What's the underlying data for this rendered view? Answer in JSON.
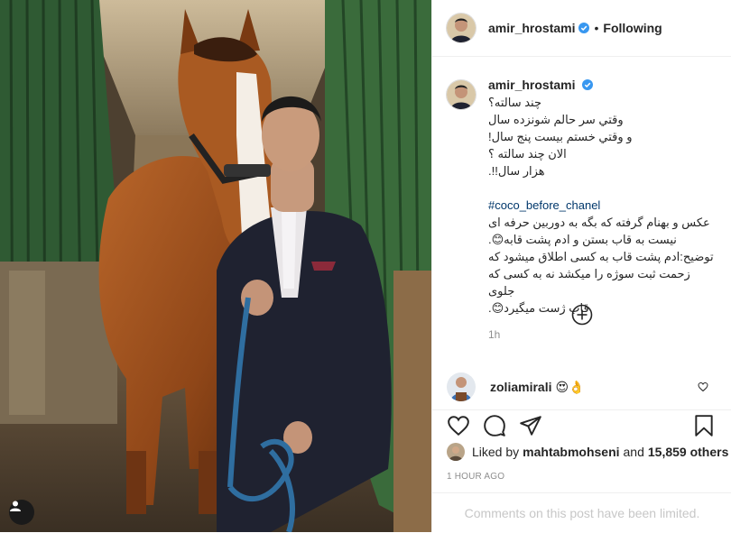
{
  "post": {
    "author": "amir_hrostami",
    "follow_status": "Following",
    "separator": "•"
  },
  "caption": {
    "author": "amir_hrostami",
    "lines": [
      "چند سالته؟",
      "وقتي سر حالم شونزده سال",
      "و وقتي خستم بيست پنج سال!",
      "الان چند سالته ؟",
      "هزار سال!!."
    ],
    "hashtag": "#coco_before_chanel",
    "lines2": [
      "عكس و بهنام گرفته كه بگه به دوربين حرفه اى",
      "نيست به قاب بستن و ادم پشت قابه😊.",
      "توضيح:ادم پشت قاب به كسى اطلاق ميشود كه",
      "زحمت ثبت سوژه را ميكشد نه به كسى كه جلوى",
      "قاب ژست ميگيرد😊."
    ],
    "time": "1h"
  },
  "comment": {
    "username": "zoliamirali",
    "text": "😍👌"
  },
  "likes": {
    "prefix": "Liked by",
    "user": "mahtabmohseni",
    "and": "and",
    "count": "15,859 others"
  },
  "timestamp": "1 HOUR AGO",
  "comments_limited": "Comments on this post have been limited.",
  "icons": [
    "heart-icon",
    "comment-icon",
    "share-icon",
    "bookmark-icon",
    "add-circle-icon",
    "verified-badge-icon",
    "tag-person-icon"
  ],
  "colors": {
    "verified": "#3897f0",
    "hashtag": "#00376b",
    "muted": "#8e8e8e"
  }
}
